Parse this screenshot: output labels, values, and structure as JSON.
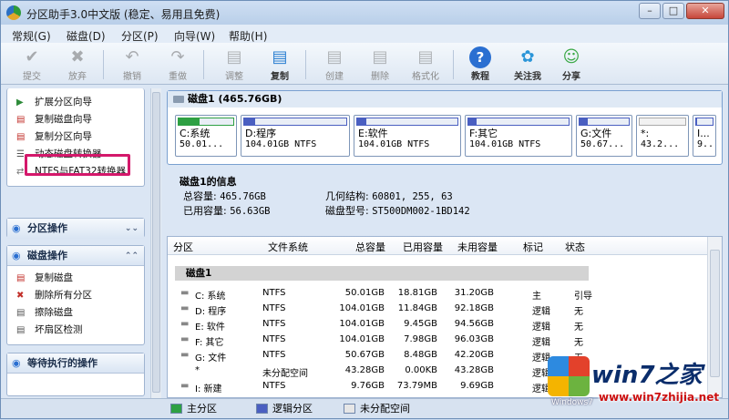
{
  "window": {
    "title": "分区助手3.0中文版 (稳定、易用且免费)"
  },
  "menu": [
    "常规(G)",
    "磁盘(D)",
    "分区(P)",
    "向导(W)",
    "帮助(H)"
  ],
  "toolbar": [
    {
      "label": "提交",
      "icon": "check-icon",
      "enabled": false
    },
    {
      "label": "放弃",
      "icon": "x-icon",
      "enabled": false
    },
    {
      "label": "撤销",
      "icon": "undo-icon",
      "enabled": false
    },
    {
      "label": "重做",
      "icon": "redo-icon",
      "enabled": false
    },
    {
      "label": "调整",
      "icon": "resize-disk-icon",
      "enabled": false
    },
    {
      "label": "复制",
      "icon": "copy-disk-icon",
      "enabled": true
    },
    {
      "label": "创建",
      "icon": "create-disk-icon",
      "enabled": false
    },
    {
      "label": "删除",
      "icon": "delete-disk-icon",
      "enabled": false
    },
    {
      "label": "格式化",
      "icon": "format-disk-icon",
      "enabled": false
    },
    {
      "label": "教程",
      "icon": "help-icon",
      "enabled": true
    },
    {
      "label": "关注我",
      "icon": "follow-bird-icon",
      "enabled": true
    },
    {
      "label": "分享",
      "icon": "share-people-icon",
      "enabled": true
    }
  ],
  "wizards": [
    {
      "label": "扩展分区向导",
      "icon": "extend-icon"
    },
    {
      "label": "复制磁盘向导",
      "icon": "copy-disk-icon"
    },
    {
      "label": "复制分区向导",
      "icon": "copy-partition-icon"
    },
    {
      "label": "动态磁盘转换器",
      "icon": "dynamic-disk-icon"
    },
    {
      "label": "NTFS与FAT32转换器",
      "icon": "convert-icon"
    }
  ],
  "partition_ops": {
    "title": "分区操作"
  },
  "disk_ops": {
    "title": "磁盘操作",
    "items": [
      {
        "label": "复制磁盘",
        "icon": "copy-disk-icon"
      },
      {
        "label": "删除所有分区",
        "icon": "delete-all-icon"
      },
      {
        "label": "擦除磁盘",
        "icon": "wipe-icon"
      },
      {
        "label": "坏扇区检测",
        "icon": "bad-sector-icon"
      }
    ]
  },
  "pending": {
    "title": "等待执行的操作"
  },
  "disk_map": {
    "title": "磁盘1 (465.76GB)",
    "partitions": [
      {
        "name": "C:系统",
        "size": "50.01...",
        "color": "#2ea043",
        "used_fraction": 0.38
      },
      {
        "name": "D:程序",
        "size": "104.01GB NTFS",
        "color": "#4a5fc1",
        "used_fraction": 0.11
      },
      {
        "name": "E:软件",
        "size": "104.01GB NTFS",
        "color": "#4a5fc1",
        "used_fraction": 0.09
      },
      {
        "name": "F:其它",
        "size": "104.01GB NTFS",
        "color": "#4a5fc1",
        "used_fraction": 0.08
      },
      {
        "name": "G:文件",
        "size": "50.67...",
        "color": "#4a5fc1",
        "used_fraction": 0.17
      },
      {
        "name": "*:",
        "size": "43.2...",
        "color": "#cccccc",
        "used_fraction": 0
      },
      {
        "name": "I...",
        "size": "9...",
        "color": "#4a5fc1",
        "used_fraction": 0.01
      }
    ]
  },
  "disk_info": {
    "title": "磁盘1的信息",
    "total_label": "总容量:",
    "total": "465.76GB",
    "used_label": "已用容量:",
    "used": "56.63GB",
    "geometry_label": "几何结构:",
    "geometry": "60801, 255, 63",
    "model_label": "磁盘型号:",
    "model": "ST500DM002-1BD142"
  },
  "table": {
    "headers": [
      "分区",
      "文件系统",
      "总容量",
      "已用容量",
      "未用容量",
      "标记",
      "状态"
    ],
    "group": "磁盘1",
    "rows": [
      {
        "name": "C: 系统",
        "fs": "NTFS",
        "total": "50.01GB",
        "used": "18.81GB",
        "free": "31.20GB",
        "flag": "主",
        "status": "引导"
      },
      {
        "name": "D: 程序",
        "fs": "NTFS",
        "total": "104.01GB",
        "used": "11.84GB",
        "free": "92.18GB",
        "flag": "逻辑",
        "status": "无"
      },
      {
        "name": "E: 软件",
        "fs": "NTFS",
        "total": "104.01GB",
        "used": "9.45GB",
        "free": "94.56GB",
        "flag": "逻辑",
        "status": "无"
      },
      {
        "name": "F: 其它",
        "fs": "NTFS",
        "total": "104.01GB",
        "used": "7.98GB",
        "free": "96.03GB",
        "flag": "逻辑",
        "status": "无"
      },
      {
        "name": "G: 文件",
        "fs": "NTFS",
        "total": "50.67GB",
        "used": "8.48GB",
        "free": "42.20GB",
        "flag": "逻辑",
        "status": "无"
      },
      {
        "name": "*",
        "fs": "未分配空间",
        "total": "43.28GB",
        "used": "0.00KB",
        "free": "43.28GB",
        "flag": "逻辑",
        "status": "无"
      },
      {
        "name": "I: 新建",
        "fs": "NTFS",
        "total": "9.76GB",
        "used": "73.79MB",
        "free": "9.69GB",
        "flag": "逻辑",
        "status": "无"
      }
    ]
  },
  "legend": [
    "主分区",
    "逻辑分区",
    "未分配空间"
  ],
  "watermark": {
    "brand": "win7之家",
    "url": "www.win7zhijia.net",
    "badge": "Windows7"
  }
}
